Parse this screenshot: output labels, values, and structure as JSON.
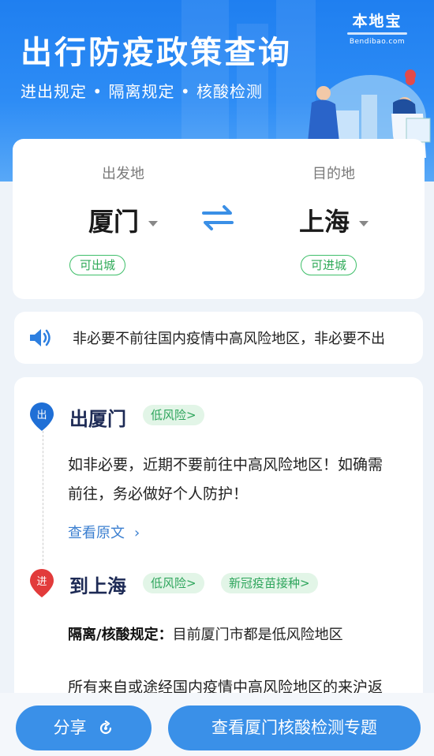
{
  "header": {
    "title": "出行防疫政策查询",
    "subtitle": "进出规定 • 隔离规定 • 核酸检测",
    "logo_main": "本地宝",
    "logo_sub": "Bendibao.com"
  },
  "route": {
    "origin_label": "出发地",
    "origin_city": "厦门",
    "origin_status": "可出城",
    "destination_label": "目的地",
    "destination_city": "上海",
    "destination_status": "可进城"
  },
  "notice": {
    "text": "非必要不前往国内疫情中高风险地区，非必要不出"
  },
  "departure": {
    "pin_label": "出",
    "title": "出厦门",
    "risk": "低风险>",
    "line1": "如非必要，近期不要前往中高风险地区！如确需",
    "line2": "前往，务必做好个人防护！",
    "link": "查看原文",
    "link_chevron": "›"
  },
  "arrival": {
    "pin_label": "进",
    "title": "到上海",
    "risk": "低风险>",
    "vaccine": "新冠疫苗接种>",
    "rule_label": "隔离/核酸规定：",
    "rule_text": "目前厦门市都是低风险地区",
    "partial": "所有来自或途经国内疫情中高风险地区的来沪返"
  },
  "footer": {
    "share": "分享",
    "topic": "查看厦门核酸检测专题"
  },
  "colors": {
    "primary": "#2d8cf5",
    "button": "#3a90e8",
    "green": "#2faa58",
    "pin_blue": "#1f6fd6",
    "pin_red": "#e23b3b",
    "title_navy": "#1d2a55"
  }
}
